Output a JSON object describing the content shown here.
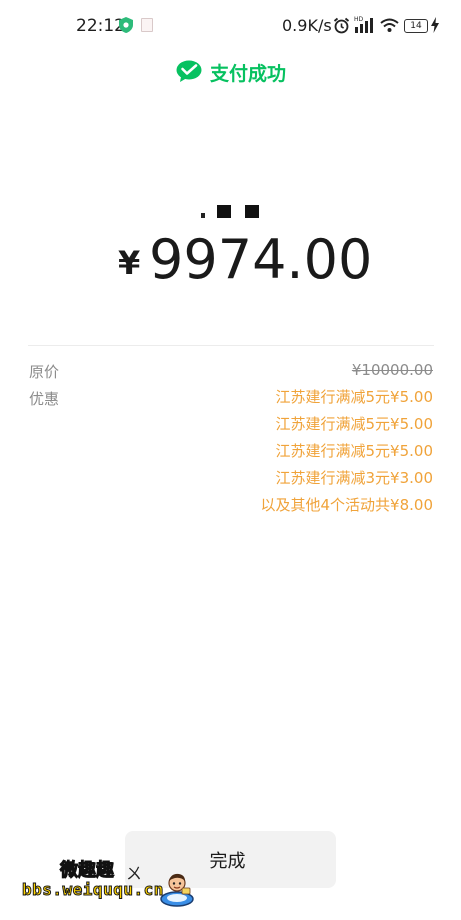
{
  "status_bar": {
    "time": "22:12",
    "network_speed": "0.9K/s",
    "battery": "14"
  },
  "header": {
    "title": "支付成功",
    "accent_color": "#07c160"
  },
  "payment": {
    "currency_symbol": "¥",
    "amount": "9974.00"
  },
  "details": {
    "original_label": "原价",
    "original_price": "¥10000.00",
    "discount_label": "优惠",
    "discount_color": "#f0a33a",
    "discounts": [
      "江苏建行满减5元¥5.00",
      "江苏建行满减5元¥5.00",
      "江苏建行满减5元¥5.00",
      "江苏建行满减3元¥3.00",
      "以及其他4个活动共¥8.00"
    ]
  },
  "actions": {
    "done_label": "完成"
  },
  "watermark": {
    "line1": "微趣趣",
    "mark": "ㄨ",
    "line2": "bbs.weiququ.cn"
  }
}
